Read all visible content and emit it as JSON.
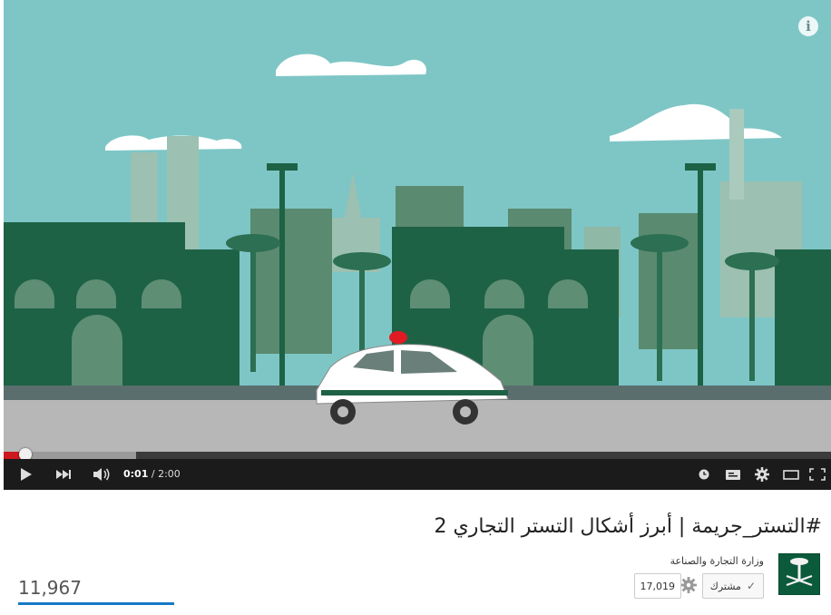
{
  "player": {
    "progress_fraction": 0.026,
    "buffered_fraction": 0.16,
    "time_current": "0:01",
    "time_separator": " / ",
    "time_total": "2:00",
    "info_label": "i",
    "colors": {
      "played": "#cc181e",
      "controls_bg": "#1b1b1b"
    },
    "icons": [
      "play-icon",
      "next-icon",
      "volume-icon",
      "watch-later-icon",
      "captions-icon",
      "settings-icon",
      "theater-mode-icon",
      "fullscreen-icon"
    ]
  },
  "video_meta": {
    "title": "#التستر_جريمة | أبرز أشكال التستر التجاري 2",
    "channel_name": "وزارة التجارة والصناعة",
    "subscribe_label": "مشترك",
    "subscriber_count": "17,019",
    "view_count": "11,967"
  }
}
